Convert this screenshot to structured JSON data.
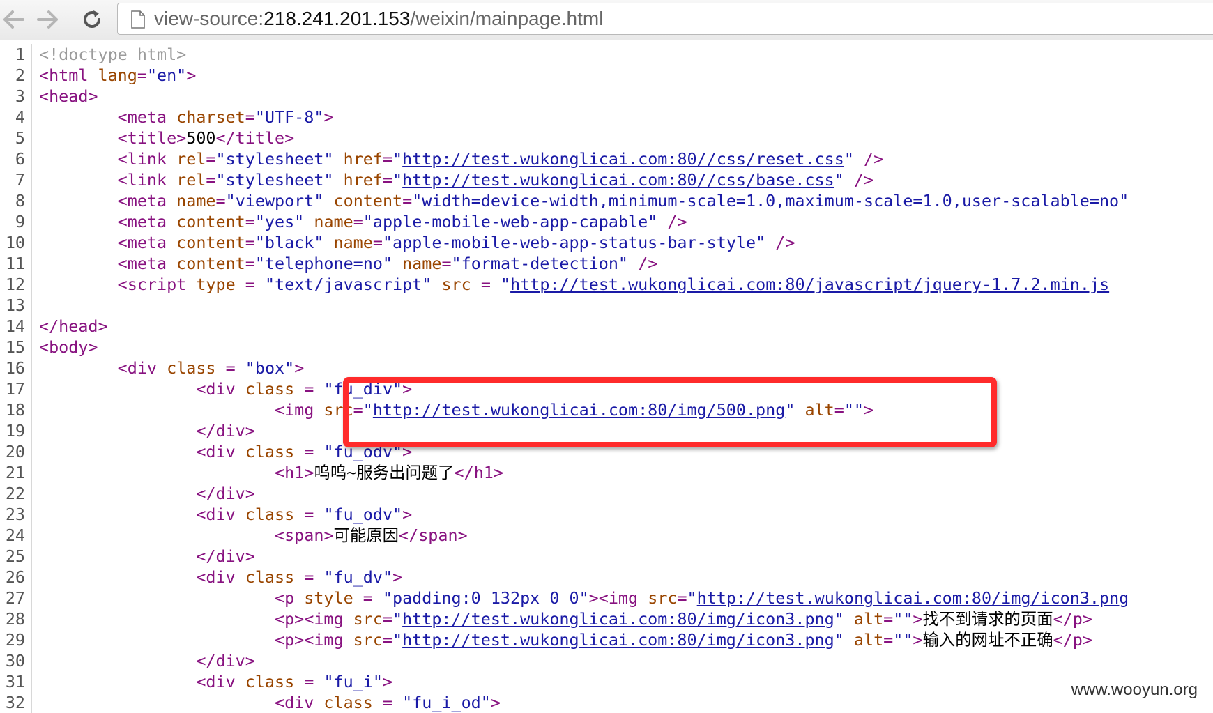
{
  "browser": {
    "url_prefix": "view-source:",
    "url_host": "218.241.201.153",
    "url_path": "/weixin/mainpage.html",
    "back_icon": "back-arrow-icon",
    "forward_icon": "forward-arrow-icon",
    "reload_icon": "reload-icon",
    "page_icon": "page-icon"
  },
  "source": {
    "lines": [
      {
        "n": "1",
        "seg": [
          [
            "c",
            "<!doctype html>"
          ]
        ]
      },
      {
        "n": "2",
        "seg": [
          [
            "t",
            "<html "
          ],
          [
            "a",
            "lang"
          ],
          [
            "t",
            "="
          ],
          [
            "v",
            "\"en\""
          ],
          [
            "t",
            ">"
          ]
        ]
      },
      {
        "n": "3",
        "seg": [
          [
            "t",
            "<head>"
          ]
        ]
      },
      {
        "n": "4",
        "seg": [
          [
            "k",
            "        "
          ],
          [
            "t",
            "<meta "
          ],
          [
            "a",
            "charset"
          ],
          [
            "t",
            "="
          ],
          [
            "v",
            "\"UTF-8\""
          ],
          [
            "t",
            ">"
          ]
        ]
      },
      {
        "n": "5",
        "seg": [
          [
            "k",
            "        "
          ],
          [
            "t",
            "<title>"
          ],
          [
            "k",
            "500"
          ],
          [
            "t",
            "</title>"
          ]
        ]
      },
      {
        "n": "6",
        "seg": [
          [
            "k",
            "        "
          ],
          [
            "t",
            "<link "
          ],
          [
            "a",
            "rel"
          ],
          [
            "t",
            "="
          ],
          [
            "v",
            "\"stylesheet\""
          ],
          [
            "k",
            " "
          ],
          [
            "a",
            "href"
          ],
          [
            "t",
            "="
          ],
          [
            "v",
            "\""
          ],
          [
            "l",
            "http://test.wukonglicai.com:80//css/reset.css"
          ],
          [
            "v",
            "\""
          ],
          [
            "k",
            " "
          ],
          [
            "t",
            "/>"
          ]
        ]
      },
      {
        "n": "7",
        "seg": [
          [
            "k",
            "        "
          ],
          [
            "t",
            "<link "
          ],
          [
            "a",
            "rel"
          ],
          [
            "t",
            "="
          ],
          [
            "v",
            "\"stylesheet\""
          ],
          [
            "k",
            " "
          ],
          [
            "a",
            "href"
          ],
          [
            "t",
            "="
          ],
          [
            "v",
            "\""
          ],
          [
            "l",
            "http://test.wukonglicai.com:80//css/base.css"
          ],
          [
            "v",
            "\""
          ],
          [
            "k",
            " "
          ],
          [
            "t",
            "/>"
          ]
        ]
      },
      {
        "n": "8",
        "seg": [
          [
            "k",
            "        "
          ],
          [
            "t",
            "<meta "
          ],
          [
            "a",
            "name"
          ],
          [
            "t",
            "="
          ],
          [
            "v",
            "\"viewport\""
          ],
          [
            "k",
            " "
          ],
          [
            "a",
            "content"
          ],
          [
            "t",
            "="
          ],
          [
            "v",
            "\"width=device-width,minimum-scale=1.0,maximum-scale=1.0,user-scalable=no\""
          ]
        ]
      },
      {
        "n": "9",
        "seg": [
          [
            "k",
            "        "
          ],
          [
            "t",
            "<meta "
          ],
          [
            "a",
            "content"
          ],
          [
            "t",
            "="
          ],
          [
            "v",
            "\"yes\""
          ],
          [
            "k",
            " "
          ],
          [
            "a",
            "name"
          ],
          [
            "t",
            "="
          ],
          [
            "v",
            "\"apple-mobile-web-app-capable\""
          ],
          [
            "k",
            " "
          ],
          [
            "t",
            "/>"
          ]
        ]
      },
      {
        "n": "10",
        "seg": [
          [
            "k",
            "        "
          ],
          [
            "t",
            "<meta "
          ],
          [
            "a",
            "content"
          ],
          [
            "t",
            "="
          ],
          [
            "v",
            "\"black\""
          ],
          [
            "k",
            " "
          ],
          [
            "a",
            "name"
          ],
          [
            "t",
            "="
          ],
          [
            "v",
            "\"apple-mobile-web-app-status-bar-style\""
          ],
          [
            "k",
            " "
          ],
          [
            "t",
            "/>"
          ]
        ]
      },
      {
        "n": "11",
        "seg": [
          [
            "k",
            "        "
          ],
          [
            "t",
            "<meta "
          ],
          [
            "a",
            "content"
          ],
          [
            "t",
            "="
          ],
          [
            "v",
            "\"telephone=no\""
          ],
          [
            "k",
            " "
          ],
          [
            "a",
            "name"
          ],
          [
            "t",
            "="
          ],
          [
            "v",
            "\"format-detection\""
          ],
          [
            "k",
            " "
          ],
          [
            "t",
            "/>"
          ]
        ]
      },
      {
        "n": "12",
        "seg": [
          [
            "k",
            "        "
          ],
          [
            "t",
            "<script "
          ],
          [
            "a",
            "type"
          ],
          [
            "k",
            " "
          ],
          [
            "t",
            "="
          ],
          [
            "k",
            " "
          ],
          [
            "v",
            "\"text/javascript\""
          ],
          [
            "k",
            " "
          ],
          [
            "a",
            "src"
          ],
          [
            "k",
            " "
          ],
          [
            "t",
            "="
          ],
          [
            "k",
            " "
          ],
          [
            "v",
            "\""
          ],
          [
            "l",
            "http://test.wukonglicai.com:80/javascript/jquery-1.7.2.min.js"
          ]
        ]
      },
      {
        "n": "13",
        "seg": []
      },
      {
        "n": "14",
        "seg": [
          [
            "t",
            "</head>"
          ]
        ]
      },
      {
        "n": "15",
        "seg": [
          [
            "t",
            "<body>"
          ]
        ]
      },
      {
        "n": "16",
        "seg": [
          [
            "k",
            "        "
          ],
          [
            "t",
            "<div "
          ],
          [
            "a",
            "class"
          ],
          [
            "k",
            " "
          ],
          [
            "t",
            "="
          ],
          [
            "k",
            " "
          ],
          [
            "v",
            "\"box\""
          ],
          [
            "t",
            ">"
          ]
        ]
      },
      {
        "n": "17",
        "seg": [
          [
            "k",
            "                "
          ],
          [
            "t",
            "<div "
          ],
          [
            "a",
            "class"
          ],
          [
            "k",
            " "
          ],
          [
            "t",
            "="
          ],
          [
            "k",
            " "
          ],
          [
            "v",
            "\"fu_div\""
          ],
          [
            "t",
            ">"
          ]
        ]
      },
      {
        "n": "18",
        "seg": [
          [
            "k",
            "                        "
          ],
          [
            "t",
            "<img "
          ],
          [
            "a",
            "src"
          ],
          [
            "t",
            "="
          ],
          [
            "v",
            "\""
          ],
          [
            "l",
            "http://test.wukonglicai.com:80/img/500.png"
          ],
          [
            "v",
            "\""
          ],
          [
            "k",
            " "
          ],
          [
            "a",
            "alt"
          ],
          [
            "t",
            "="
          ],
          [
            "v",
            "\"\""
          ],
          [
            "t",
            ">"
          ]
        ]
      },
      {
        "n": "19",
        "seg": [
          [
            "k",
            "                "
          ],
          [
            "t",
            "</div>"
          ]
        ]
      },
      {
        "n": "20",
        "seg": [
          [
            "k",
            "                "
          ],
          [
            "t",
            "<div "
          ],
          [
            "a",
            "class"
          ],
          [
            "k",
            " "
          ],
          [
            "t",
            "="
          ],
          [
            "k",
            " "
          ],
          [
            "v",
            "\"fu_odv\""
          ],
          [
            "t",
            ">"
          ]
        ]
      },
      {
        "n": "21",
        "seg": [
          [
            "k",
            "                        "
          ],
          [
            "t",
            "<h1>"
          ],
          [
            "k",
            "呜呜~服务出问题了"
          ],
          [
            "t",
            "</h1>"
          ]
        ]
      },
      {
        "n": "22",
        "seg": [
          [
            "k",
            "                "
          ],
          [
            "t",
            "</div>"
          ]
        ]
      },
      {
        "n": "23",
        "seg": [
          [
            "k",
            "                "
          ],
          [
            "t",
            "<div "
          ],
          [
            "a",
            "class"
          ],
          [
            "k",
            " "
          ],
          [
            "t",
            "="
          ],
          [
            "k",
            " "
          ],
          [
            "v",
            "\"fu_odv\""
          ],
          [
            "t",
            ">"
          ]
        ]
      },
      {
        "n": "24",
        "seg": [
          [
            "k",
            "                        "
          ],
          [
            "t",
            "<span>"
          ],
          [
            "k",
            "可能原因"
          ],
          [
            "t",
            "</span>"
          ]
        ]
      },
      {
        "n": "25",
        "seg": [
          [
            "k",
            "                "
          ],
          [
            "t",
            "</div>"
          ]
        ]
      },
      {
        "n": "26",
        "seg": [
          [
            "k",
            "                "
          ],
          [
            "t",
            "<div "
          ],
          [
            "a",
            "class"
          ],
          [
            "k",
            " "
          ],
          [
            "t",
            "="
          ],
          [
            "k",
            " "
          ],
          [
            "v",
            "\"fu_dv\""
          ],
          [
            "t",
            ">"
          ]
        ]
      },
      {
        "n": "27",
        "seg": [
          [
            "k",
            "                        "
          ],
          [
            "t",
            "<p "
          ],
          [
            "a",
            "style"
          ],
          [
            "k",
            " "
          ],
          [
            "t",
            "="
          ],
          [
            "k",
            " "
          ],
          [
            "v",
            "\"padding:0 132px 0 0\""
          ],
          [
            "t",
            ">"
          ],
          [
            "t",
            "<img "
          ],
          [
            "a",
            "src"
          ],
          [
            "t",
            "="
          ],
          [
            "v",
            "\""
          ],
          [
            "l",
            "http://test.wukonglicai.com:80/img/icon3.png"
          ]
        ]
      },
      {
        "n": "28",
        "seg": [
          [
            "k",
            "                        "
          ],
          [
            "t",
            "<p>"
          ],
          [
            "t",
            "<img "
          ],
          [
            "a",
            "src"
          ],
          [
            "t",
            "="
          ],
          [
            "v",
            "\""
          ],
          [
            "l",
            "http://test.wukonglicai.com:80/img/icon3.png"
          ],
          [
            "v",
            "\""
          ],
          [
            "k",
            " "
          ],
          [
            "a",
            "alt"
          ],
          [
            "t",
            "="
          ],
          [
            "v",
            "\"\""
          ],
          [
            "t",
            ">"
          ],
          [
            "k",
            "找不到请求的页面"
          ],
          [
            "t",
            "</p>"
          ]
        ]
      },
      {
        "n": "29",
        "seg": [
          [
            "k",
            "                        "
          ],
          [
            "t",
            "<p>"
          ],
          [
            "t",
            "<img "
          ],
          [
            "a",
            "src"
          ],
          [
            "t",
            "="
          ],
          [
            "v",
            "\""
          ],
          [
            "l",
            "http://test.wukonglicai.com:80/img/icon3.png"
          ],
          [
            "v",
            "\""
          ],
          [
            "k",
            " "
          ],
          [
            "a",
            "alt"
          ],
          [
            "t",
            "="
          ],
          [
            "v",
            "\"\""
          ],
          [
            "t",
            ">"
          ],
          [
            "k",
            "输入的网址不正确"
          ],
          [
            "t",
            "</p>"
          ]
        ]
      },
      {
        "n": "30",
        "seg": [
          [
            "k",
            "                "
          ],
          [
            "t",
            "</div>"
          ]
        ]
      },
      {
        "n": "31",
        "seg": [
          [
            "k",
            "                "
          ],
          [
            "t",
            "<div "
          ],
          [
            "a",
            "class"
          ],
          [
            "k",
            " "
          ],
          [
            "t",
            "="
          ],
          [
            "k",
            " "
          ],
          [
            "v",
            "\"fu_i\""
          ],
          [
            "t",
            ">"
          ]
        ]
      },
      {
        "n": "32",
        "seg": [
          [
            "k",
            "                        "
          ],
          [
            "t",
            "<div "
          ],
          [
            "a",
            "class"
          ],
          [
            "k",
            " "
          ],
          [
            "t",
            "="
          ],
          [
            "k",
            " "
          ],
          [
            "v",
            "\"fu_i_od\""
          ],
          [
            "t",
            ">"
          ]
        ]
      }
    ]
  },
  "highlight": {
    "color": "#ff2b2b"
  },
  "watermark": {
    "text": "www.wooyun.org"
  }
}
